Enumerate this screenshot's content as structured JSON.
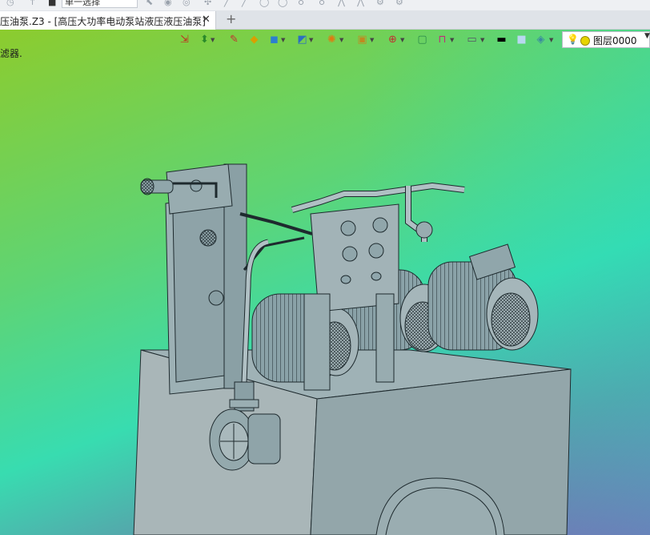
{
  "toolbar_top": {
    "selection_mode": "单一选择"
  },
  "tabs": {
    "document_tab": "压油泵.Z3 - [高压大功率电动泵站液压液压油泵]",
    "close_symbol": "✕",
    "add_symbol": "+"
  },
  "viewport": {
    "prompt_text": "滤器.",
    "background_colors": [
      "#8ccc2e",
      "#38dcb0",
      "#8a55b8"
    ],
    "model_color": "#8fa6ac"
  },
  "view_toolbar": {
    "icons": [
      "import-icon",
      "arrow-icon",
      "pencil-icon",
      "box-shaded-icon",
      "cube-icon",
      "cube-view-icon",
      "sphere-icon",
      "zoom-icon",
      "target-icon",
      "frame-icon",
      "dimension-icon",
      "monitor-icon",
      "line-color-icon",
      "fill-color-icon",
      "layers-icon"
    ],
    "layer_label": "图层0000"
  }
}
